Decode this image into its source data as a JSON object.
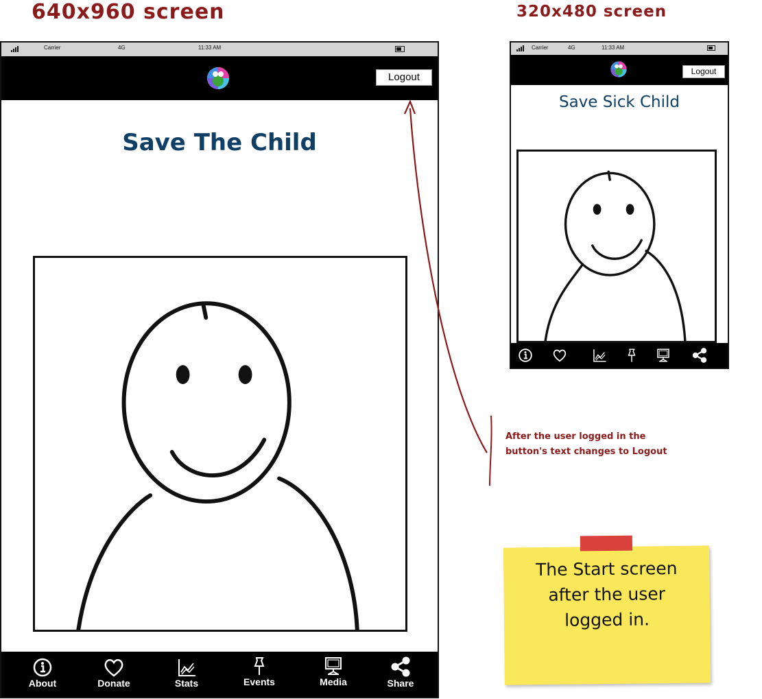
{
  "large_screen": {
    "heading": "640x960 screen",
    "status_bar": {
      "carrier": "Carrier",
      "network": "4G",
      "time": "11:33 AM"
    },
    "logout_label": "Logout",
    "title": "Save The Child",
    "tabs": [
      {
        "label": "About",
        "icon": "info-icon"
      },
      {
        "label": "Donate",
        "icon": "heart-icon"
      },
      {
        "label": "Stats",
        "icon": "chart-icon"
      },
      {
        "label": "Events",
        "icon": "pin-icon"
      },
      {
        "label": "Media",
        "icon": "monitor-icon"
      },
      {
        "label": "Share",
        "icon": "share-icon"
      }
    ]
  },
  "small_screen": {
    "heading": "320x480 screen",
    "status_bar": {
      "carrier": "Carrier",
      "network": "4G",
      "time": "11:33 AM"
    },
    "logout_label": "Logout",
    "title": "Save Sick Child",
    "tab_icons": [
      "info-icon",
      "heart-icon",
      "chart-icon",
      "pin-icon",
      "monitor-icon",
      "share-icon"
    ]
  },
  "annotation": {
    "line1": "After the user logged in the",
    "line2": "button's text changes to Logout"
  },
  "sticky_note": {
    "line1": "The Start screen",
    "line2": "after the user",
    "line3": "logged in."
  },
  "colors": {
    "heading": "#8b1a1a",
    "title": "#0f3f66",
    "arrow": "#8b1a1a",
    "sticky": "#fbe75a",
    "tape": "#d9413d",
    "bar": "#000000"
  }
}
